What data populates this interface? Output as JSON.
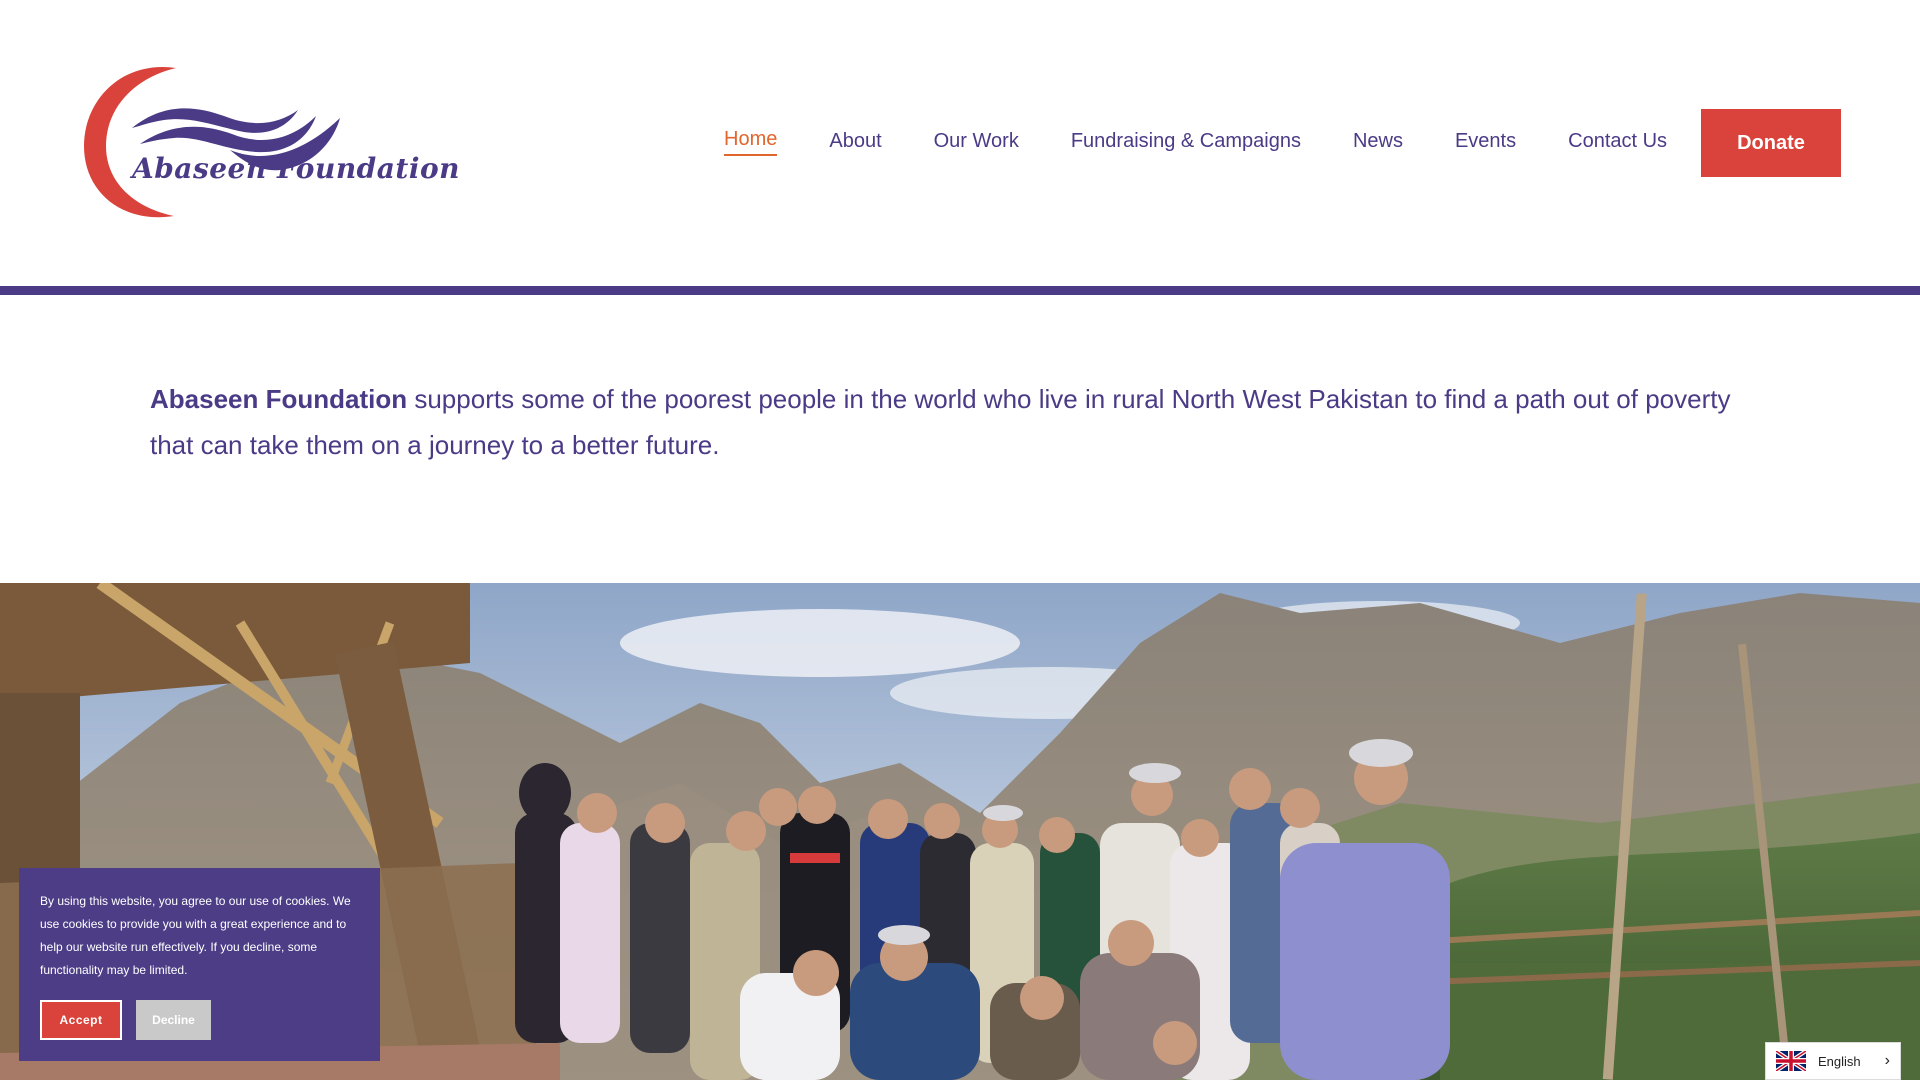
{
  "header": {
    "logo_text": "Abaseen Foundation",
    "nav": [
      {
        "label": "Home",
        "active": true
      },
      {
        "label": "About",
        "active": false
      },
      {
        "label": "Our Work",
        "active": false
      },
      {
        "label": "Fundraising & Campaigns",
        "active": false
      },
      {
        "label": "News",
        "active": false
      },
      {
        "label": "Events",
        "active": false
      },
      {
        "label": "Contact Us",
        "active": false
      }
    ],
    "donate_label": "Donate"
  },
  "intro": {
    "org_name": "Abaseen Foundation",
    "text": " supports some of the poorest people in the world who live in rural North West Pakistan to find a path out of poverty that can take them on a journey to a better future."
  },
  "cookie_banner": {
    "text": "By using this website, you agree to our use of cookies. We use cookies to provide you with a great experience and to help our website run effectively. If you decline, some functionality may be limited.",
    "accept_label": "Accept",
    "decline_label": "Decline"
  },
  "language": {
    "label": "English",
    "flag_icon": "uk-flag-icon",
    "chevron_icon": "chevron-right-icon"
  },
  "colors": {
    "brand_purple": "#4b3b86",
    "brand_red": "#d9433b",
    "active_orange": "#e0662d"
  }
}
